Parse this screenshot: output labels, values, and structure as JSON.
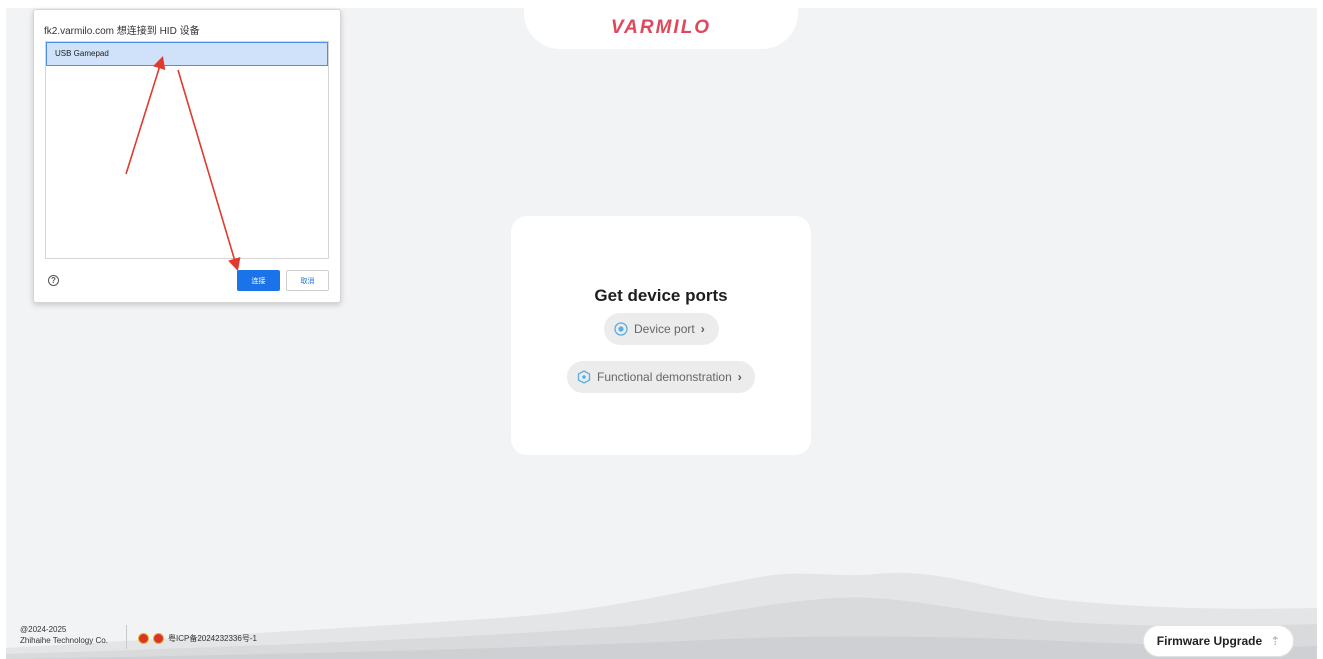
{
  "app": {
    "logo": "VARMILO",
    "card": {
      "title": "Get device ports",
      "device_port_label": "Device port",
      "functional_demo_label": "Functional demonstration"
    },
    "footer": {
      "copyright_years": "@2024-2025",
      "company": "Zhihaihe Technology Co.",
      "icp": "粤ICP备2024232336号-1"
    },
    "firmware_upgrade_label": "Firmware Upgrade"
  },
  "dialog": {
    "title": "fk2.varmilo.com 想连接到 HID 设备",
    "devices": [
      "USB Gamepad"
    ],
    "connect_label": "连接",
    "cancel_label": "取消",
    "help_symbol": "?"
  },
  "colors": {
    "brand": "#e0475a",
    "background": "#f2f3f5",
    "dialog_accent": "#1a73e8",
    "selection": "#cfe2fa",
    "annotation_arrow": "#e03a2f",
    "icon_accent": "#5aaee0"
  },
  "icons": {
    "device_port": "device-port-icon",
    "functional_demo": "hexagon-icon",
    "firmware_upgrade": "upload-arrow-icon",
    "help": "help-icon"
  }
}
